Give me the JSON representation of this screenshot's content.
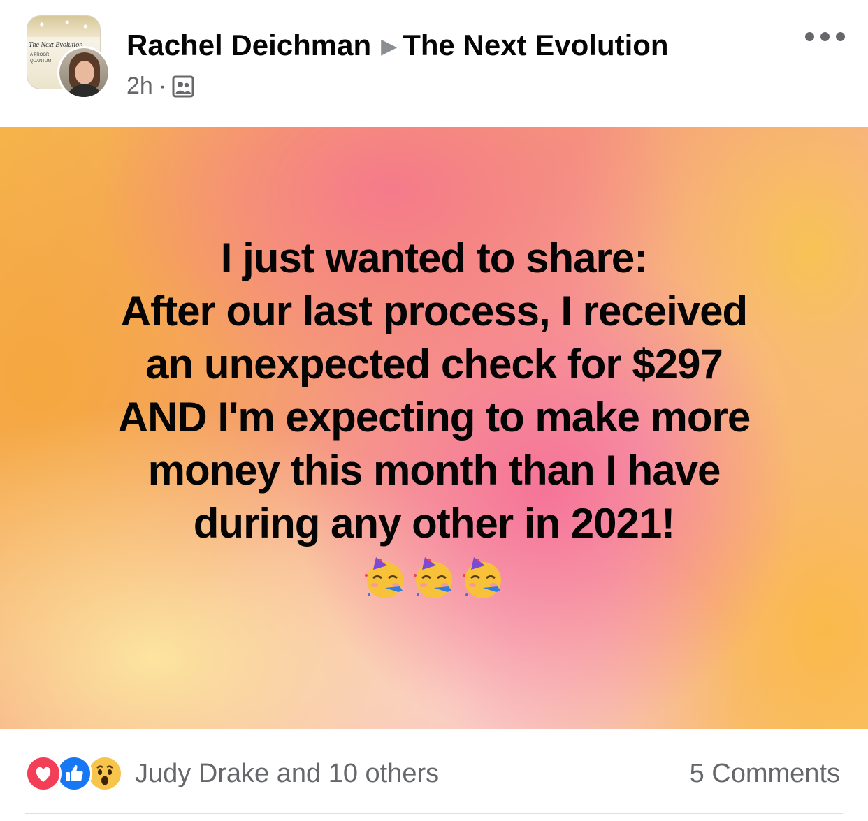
{
  "header": {
    "author_name": "Rachel Deichman",
    "group_name": "The Next Evolution",
    "timestamp": "2h",
    "separator": "·",
    "privacy_icon": "group-members-icon",
    "more_icon": "more-horizontal-icon",
    "group_avatar_text": "The Next Evolution",
    "group_avatar_subtext": "A PROGR\nQUANTUM"
  },
  "post": {
    "lines": [
      "I just wanted to share:",
      "After our last process, I received",
      "an unexpected check for $297",
      "AND I'm expecting to make more",
      "money this month than I have",
      "during any other in 2021!"
    ],
    "emoji": [
      "partying-face",
      "partying-face",
      "partying-face"
    ]
  },
  "footer": {
    "reactions": [
      "love",
      "like",
      "wow"
    ],
    "reactor_summary": "Judy Drake and 10 others",
    "comments_count": "5 Comments"
  },
  "colors": {
    "text_primary": "#050505",
    "text_secondary": "#65676b",
    "love": "#f33e58",
    "like": "#1877f2",
    "wow": "#f7c44c"
  }
}
